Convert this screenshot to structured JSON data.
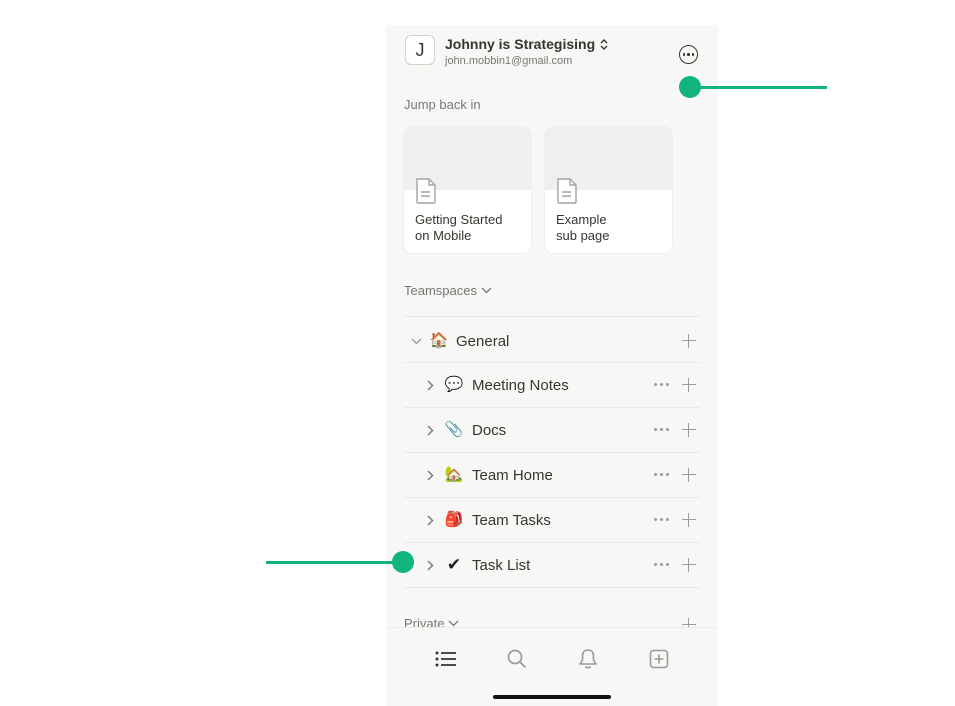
{
  "workspace": {
    "initial": "J",
    "name": "Johnny is Strategising",
    "email": "john.mobbin1@gmail.com"
  },
  "jump_back_in": {
    "label": "Jump back in",
    "cards": [
      {
        "title_line1": "Getting Started",
        "title_line2": "on Mobile",
        "icon": "document-icon"
      },
      {
        "title_line1": "Example",
        "title_line2": "sub page",
        "icon": "document-icon"
      }
    ]
  },
  "teamspaces": {
    "label": "Teamspaces",
    "general": {
      "label": "General",
      "emoji": "🏠",
      "icon": "house-icon"
    },
    "pages": [
      {
        "label": "Meeting Notes",
        "emoji": "💬",
        "icon": "speech-bubble-icon"
      },
      {
        "label": "Docs",
        "emoji": "📎",
        "icon": "paperclip-icon"
      },
      {
        "label": "Team Home",
        "emoji": "🏡",
        "icon": "home-garden-icon"
      },
      {
        "label": "Team Tasks",
        "emoji": "🎒",
        "icon": "backpack-icon"
      },
      {
        "label": "Task List",
        "emoji": "✔",
        "icon": "checkmark-icon"
      }
    ]
  },
  "private": {
    "label": "Private"
  },
  "tabbar": [
    "list-icon",
    "search-icon",
    "bell-icon",
    "new-page-icon"
  ],
  "colors": {
    "accent": "#10b47c",
    "background": "#f7f7f5",
    "text": "#37352f",
    "muted": "#787774"
  }
}
